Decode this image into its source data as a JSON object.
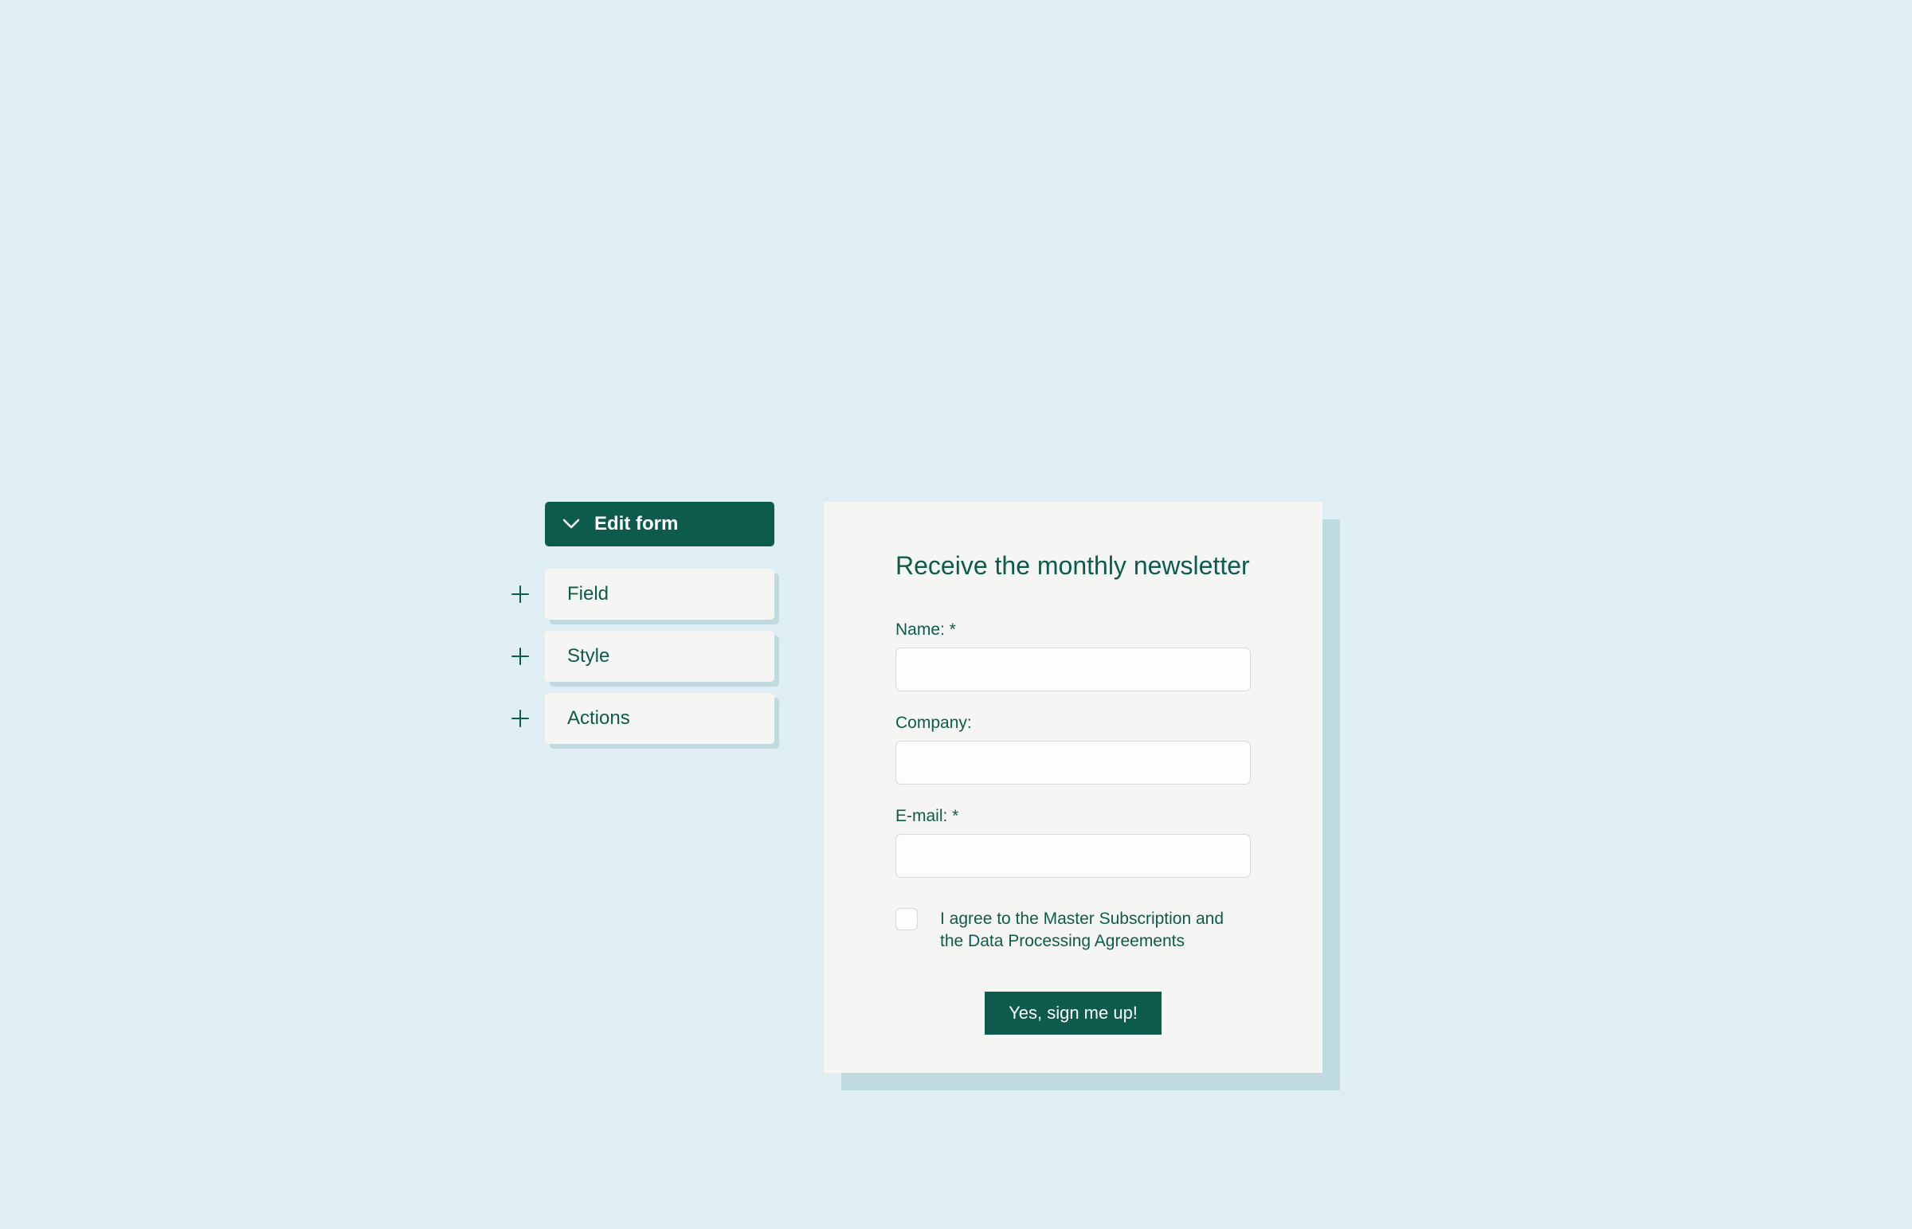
{
  "sidebar": {
    "header": "Edit form",
    "items": [
      {
        "label": "Field"
      },
      {
        "label": "Style"
      },
      {
        "label": "Actions"
      }
    ]
  },
  "form": {
    "title": "Receive the monthly newsletter",
    "fields": [
      {
        "label": "Name: *"
      },
      {
        "label": "Company:"
      },
      {
        "label": "E-mail: *"
      }
    ],
    "checkbox_label": "I agree to the Master Subscription and the Data Processing Agreements",
    "submit_label": "Yes, sign me up!"
  }
}
